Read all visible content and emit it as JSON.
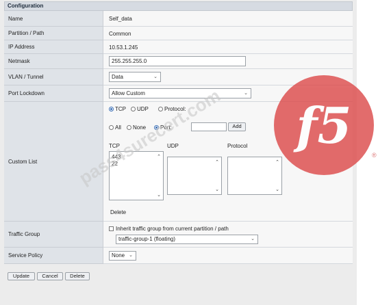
{
  "panel": {
    "title": "Configuration"
  },
  "fields": {
    "name": {
      "label": "Name",
      "value": "Self_data"
    },
    "partition": {
      "label": "Partition / Path",
      "value": "Common"
    },
    "ip": {
      "label": "IP Address",
      "value": "10.53.1.245"
    },
    "netmask": {
      "label": "Netmask",
      "value": "255.255.255.0"
    },
    "vlan": {
      "label": "VLAN / Tunnel",
      "value": "Data"
    },
    "port_lockdown": {
      "label": "Port Lockdown",
      "value": "Allow Custom"
    },
    "custom_list": {
      "label": "Custom List",
      "protocol_radios": [
        "TCP",
        "UDP",
        "Protocol:"
      ],
      "protocol_selected": "TCP",
      "port_radios": [
        "All",
        "None",
        "Port:"
      ],
      "port_selected": "Port:",
      "port_value": "",
      "add_label": "Add",
      "tcp_header": "TCP",
      "udp_header": "UDP",
      "protocol_header": "Protocol",
      "tcp_items": [
        "443",
        "22"
      ],
      "delete_label": "Delete"
    },
    "traffic_group": {
      "label": "Traffic Group",
      "inherit_label": "Inherit traffic group from current partition / path",
      "inherit_checked": false,
      "value": "traffic-group-1 (floating)"
    },
    "service_policy": {
      "label": "Service Policy",
      "value": "None"
    }
  },
  "buttons": {
    "update": "Update",
    "cancel": "Cancel",
    "delete": "Delete"
  },
  "watermark": "pass4surecert.com",
  "logo": {
    "text": "f5",
    "mark": "®"
  },
  "colors": {
    "logo": "#dc4848",
    "accent": "#3b6fb6"
  }
}
